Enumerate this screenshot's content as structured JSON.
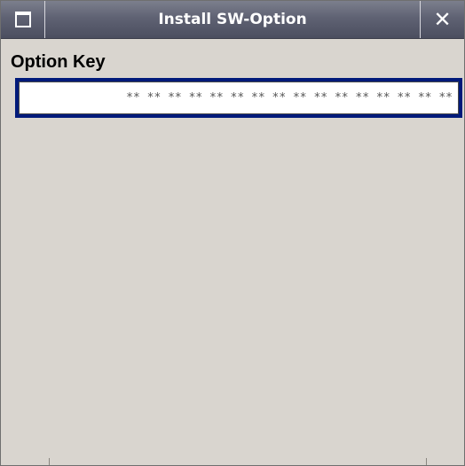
{
  "window": {
    "title": "Install SW-Option",
    "close_symbol": "✕",
    "left_icon": "window-menu-icon"
  },
  "form": {
    "option_key_label": "Option Key",
    "option_key_value": "** ** ** ** ** ** ** ** ** ** ** ** ** ** ** **"
  },
  "colors": {
    "titlebar": "#5f6273",
    "background": "#d9d5cf",
    "focus_border": "#001a7a",
    "field_background": "#ffffff"
  }
}
